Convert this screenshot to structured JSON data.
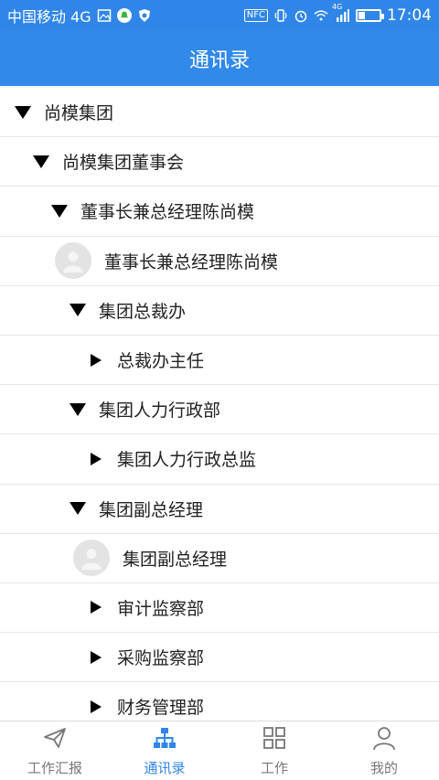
{
  "status": {
    "carrier": "中国移动 4G",
    "nfc_label": "NFC",
    "signal_tag": "4G",
    "time": "17:04",
    "battery_level": 0.3
  },
  "header": {
    "title": "通讯录"
  },
  "tree": [
    {
      "label": "尚模集团",
      "kind": "group",
      "expanded": true
    },
    {
      "label": "尚模集团董事会",
      "kind": "group",
      "expanded": true
    },
    {
      "label": "董事长兼总经理陈尚模",
      "kind": "group",
      "expanded": true
    },
    {
      "label": "董事长兼总经理陈尚模",
      "kind": "person"
    },
    {
      "label": "集团总裁办",
      "kind": "group",
      "expanded": true
    },
    {
      "label": "总裁办主任",
      "kind": "group",
      "expanded": false
    },
    {
      "label": "集团人力行政部",
      "kind": "group",
      "expanded": true
    },
    {
      "label": "集团人力行政总监",
      "kind": "group",
      "expanded": false
    },
    {
      "label": "集团副总经理",
      "kind": "group",
      "expanded": true
    },
    {
      "label": "集团副总经理",
      "kind": "person"
    },
    {
      "label": "审计监察部",
      "kind": "group",
      "expanded": false
    },
    {
      "label": "采购监察部",
      "kind": "group",
      "expanded": false
    },
    {
      "label": "财务管理部",
      "kind": "group",
      "expanded": false
    }
  ],
  "bottom_nav": [
    {
      "label": "工作汇报",
      "icon": "paper-plane-icon",
      "active": false
    },
    {
      "label": "通讯录",
      "icon": "org-chart-icon",
      "active": true
    },
    {
      "label": "工作",
      "icon": "grid-icon",
      "active": false
    },
    {
      "label": "我的",
      "icon": "user-icon",
      "active": false
    }
  ],
  "colors": {
    "primary": "#2f86e8",
    "inactive": "#777777"
  }
}
